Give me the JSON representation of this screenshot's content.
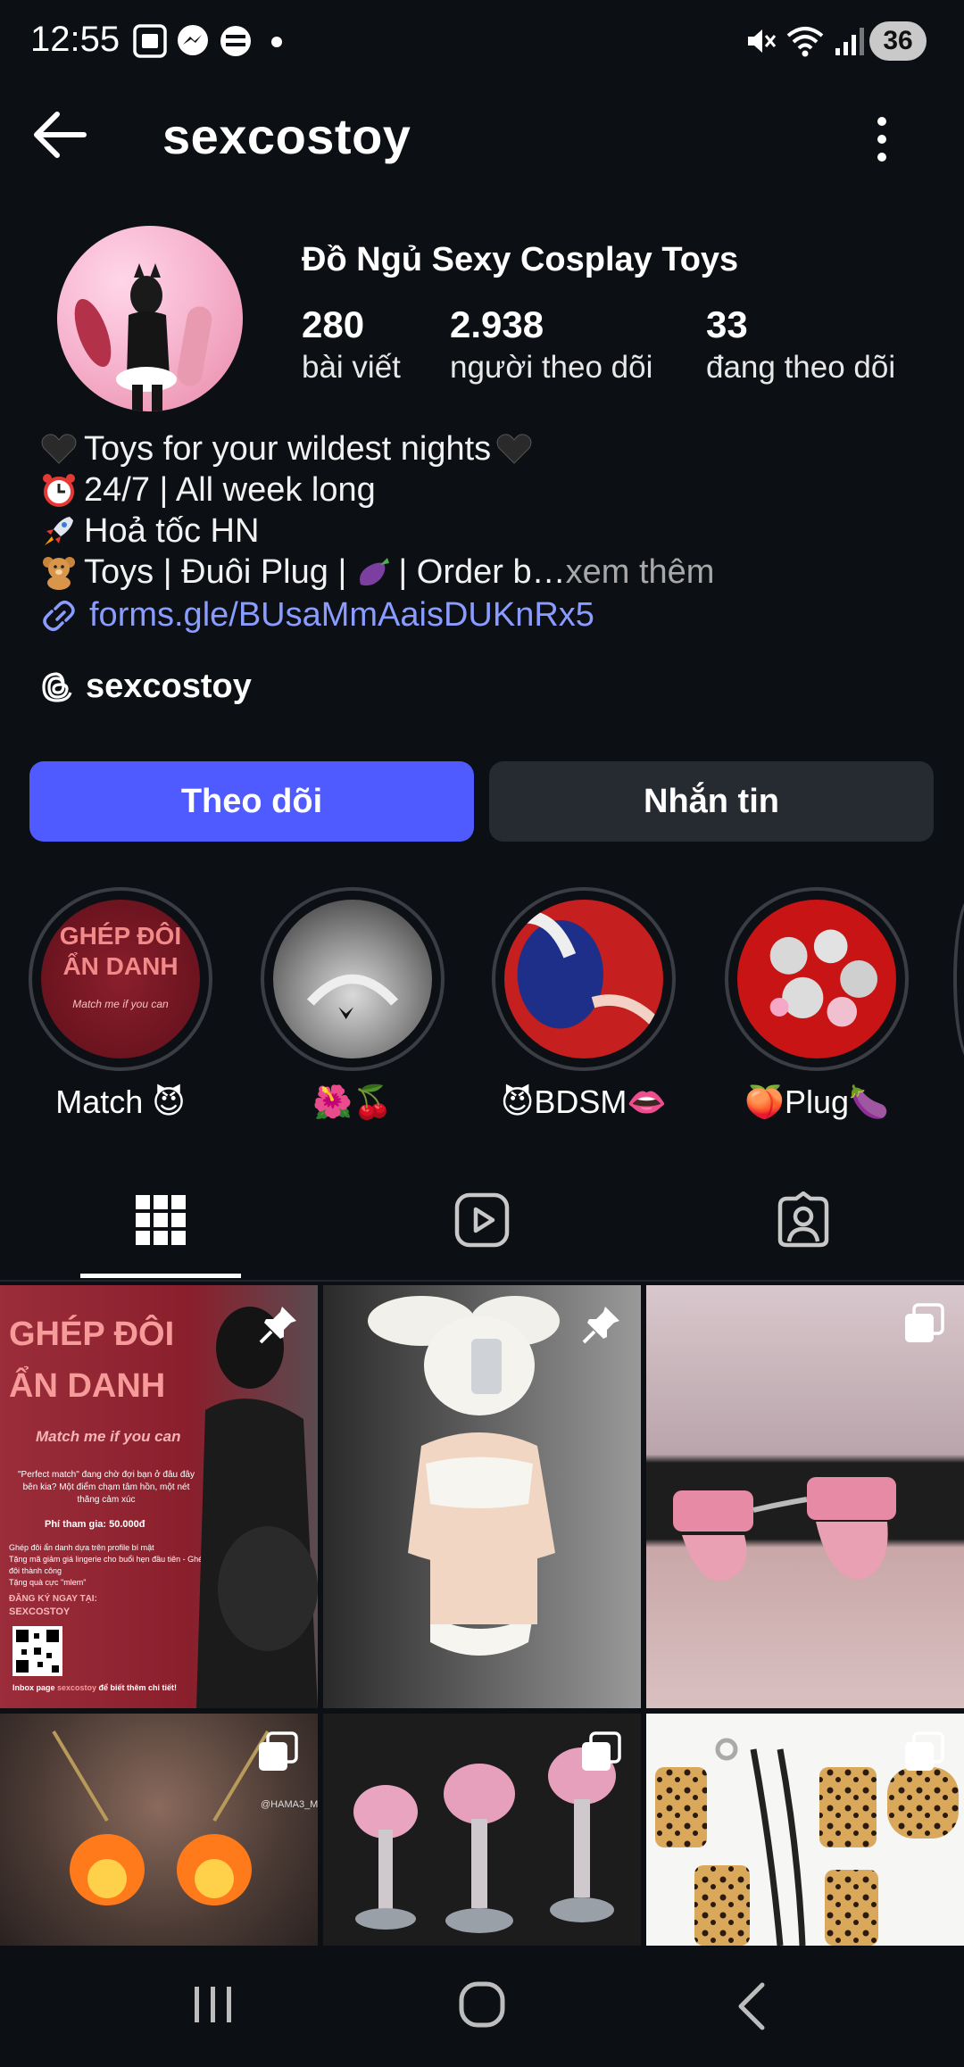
{
  "status_bar": {
    "time": "12:55",
    "battery": "36"
  },
  "header": {
    "username": "sexcostoy"
  },
  "profile": {
    "full_name": "Đồ Ngủ Sexy Cosplay Toys",
    "stats": [
      {
        "value": "280",
        "label": "bài viết"
      },
      {
        "value": "2.938",
        "label": "người theo dõi"
      },
      {
        "value": "33",
        "label": "đang theo dõi"
      }
    ],
    "bio": [
      "Toys for your wildest nights",
      "24/7 | All week long",
      "Hoả tốc HN",
      "Toys | Đuôi Plug |",
      "| Order b…"
    ],
    "see_more": " xem thêm",
    "link": "forms.gle/BUsaMmAaisDUKnRx5",
    "threads_handle": "sexcostoy"
  },
  "buttons": {
    "follow": "Theo dõi",
    "message": "Nhắn tin"
  },
  "highlights": [
    {
      "label": "Match 😈",
      "cover_text": [
        "GHÉP ĐÔI",
        "ẨN DANH",
        "Match me if you can"
      ]
    },
    {
      "label": "🌺🍒"
    },
    {
      "label": "😈BDSM👄"
    },
    {
      "label": "🍑Plug🍆"
    }
  ],
  "tabs": [
    "grid-tab",
    "reels-tab",
    "tagged-tab"
  ],
  "posts": {
    "post1": {
      "title1": "GHÉP ĐÔI",
      "title2": "ẨN DANH",
      "subtitle": "Match me if you can",
      "body": "\"Perfect match\" đang chờ đợi bạn ở đâu đây bên kia? Một điểm chạm tâm hồn, một nét thăng cảm xúc",
      "price": "Phí tham gia: 50.000đ",
      "bullets": [
        "Ghép đôi ẩn danh dựa trên profile bí mật",
        "Tặng mã giảm giá lingerie cho buổi hẹn đầu tiên - Ghép đôi thành công",
        "Tặng quà cực \"mlem\""
      ],
      "cta": "ĐĂNG KÝ NGAY TẠI:",
      "brand": "SEXCOSTOY",
      "footer_pre": "Inbox page ",
      "footer_brand": "sexcostoy",
      "footer_post": " để biết thêm chi tiết!"
    },
    "post4_watermark": "@HAMA3_M"
  },
  "colors": {
    "accent": "#4f5bff",
    "link": "#8a9cff",
    "background": "#0c0f14"
  }
}
